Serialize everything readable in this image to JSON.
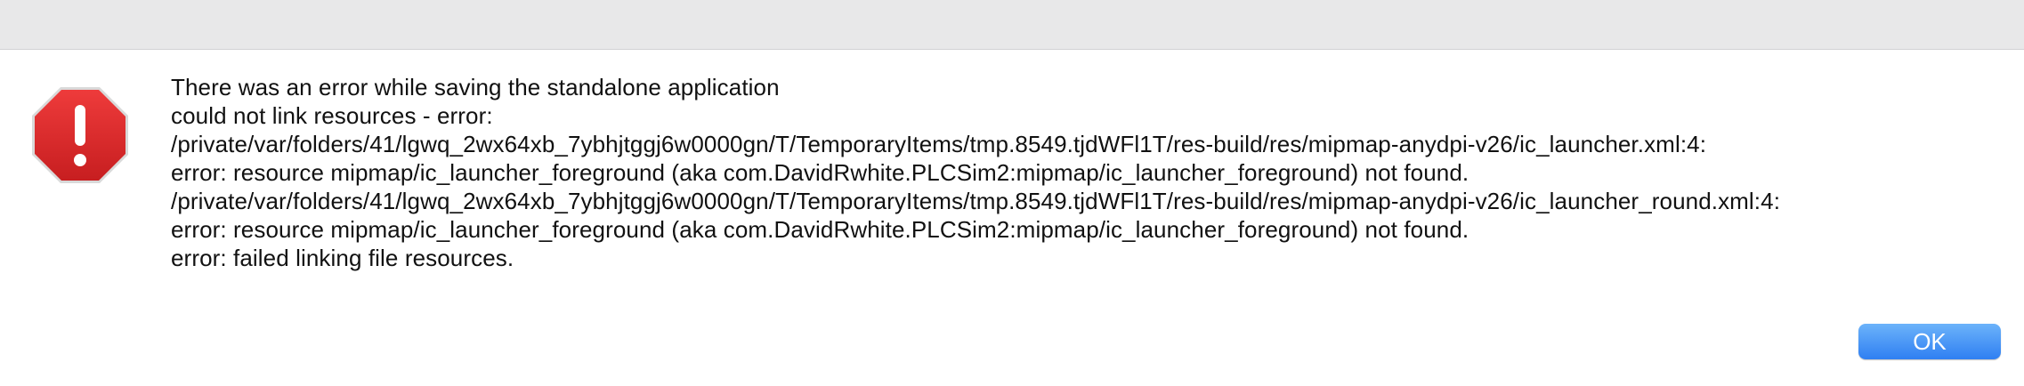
{
  "dialog": {
    "icon": "stop-exclamation-icon",
    "message_lines": [
      "There was an error while saving the standalone application",
      "could not link resources - error:",
      "/private/var/folders/41/lgwq_2wx64xb_7ybhjtggj6w0000gn/T/TemporaryItems/tmp.8549.tjdWFl1T/res-build/res/mipmap-anydpi-v26/ic_launcher.xml:4:",
      "error: resource mipmap/ic_launcher_foreground (aka com.DavidRwhite.PLCSim2:mipmap/ic_launcher_foreground) not found.",
      "/private/var/folders/41/lgwq_2wx64xb_7ybhjtggj6w0000gn/T/TemporaryItems/tmp.8549.tjdWFl1T/res-build/res/mipmap-anydpi-v26/ic_launcher_round.xml:4:",
      "error: resource mipmap/ic_launcher_foreground (aka com.DavidRwhite.PLCSim2:mipmap/ic_launcher_foreground) not found.",
      "error: failed linking file resources."
    ],
    "ok_label": "OK"
  },
  "colors": {
    "icon_red": "#d9282a",
    "button_blue": "#3d8ef5",
    "titlebar": "#e8e8e9"
  }
}
